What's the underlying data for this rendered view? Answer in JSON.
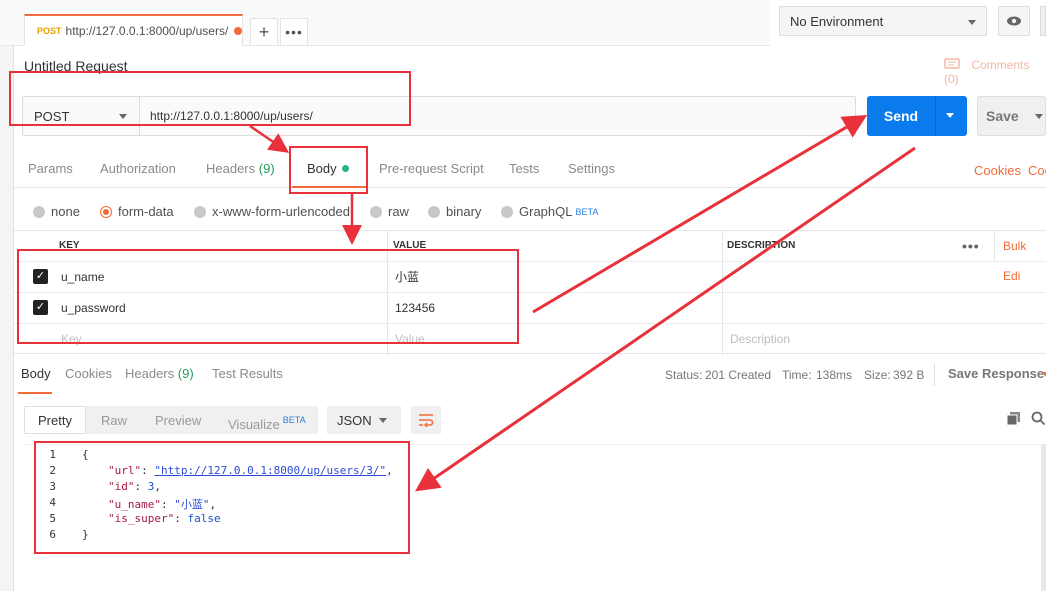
{
  "tab": {
    "method": "POST",
    "url": "http://127.0.0.1:8000/up/users/"
  },
  "environment": {
    "selected": "No Environment"
  },
  "request": {
    "title": "Untitled Request",
    "comments": "Comments (0)",
    "method": "POST",
    "url": "http://127.0.0.1:8000/up/users/",
    "send": "Send",
    "save": "Save"
  },
  "subtabs": {
    "params": "Params",
    "authorization": "Authorization",
    "headers": "Headers",
    "headers_count": "(9)",
    "body": "Body",
    "prerequest": "Pre-request Script",
    "tests": "Tests",
    "settings": "Settings",
    "cookies": "Cookies",
    "code": "Coc"
  },
  "body_types": {
    "none": "none",
    "form_data": "form-data",
    "urlencoded": "x-www-form-urlencoded",
    "raw": "raw",
    "binary": "binary",
    "graphql": "GraphQL",
    "beta": "BETA"
  },
  "kv": {
    "headers": {
      "key": "KEY",
      "value": "VALUE",
      "description": "DESCRIPTION",
      "bulk": "Bulk Edi"
    },
    "rows": [
      {
        "key": "u_name",
        "value": "小蓝",
        "checked": true
      },
      {
        "key": "u_password",
        "value": "123456",
        "checked": true
      }
    ],
    "placeholder": {
      "key": "Key",
      "value": "Value",
      "description": "Description"
    }
  },
  "response": {
    "tabs": {
      "body": "Body",
      "cookies": "Cookies",
      "headers": "Headers",
      "headers_count": "(9)",
      "tests": "Test Results"
    },
    "status_label": "Status:",
    "status_value": "201 Created",
    "time_label": "Time:",
    "time_value": "138ms",
    "size_label": "Size:",
    "size_value": "392 B",
    "save": "Save Response",
    "views": {
      "pretty": "Pretty",
      "raw": "Raw",
      "preview": "Preview",
      "visualize": "Visualize",
      "beta": "BETA"
    },
    "format": "JSON",
    "code": {
      "ln": [
        "1",
        "2",
        "3",
        "4",
        "5",
        "6"
      ],
      "open": "{",
      "url_key": "\"url\"",
      "url_val": "\"http://127.0.0.1:8000/up/users/3/\"",
      "id_key": "\"id\"",
      "id_val": "3",
      "name_key": "\"u_name\"",
      "name_val": "\"小蓝\"",
      "super_key": "\"is_super\"",
      "super_val": "false",
      "close": "}"
    }
  },
  "colors": {
    "accent": "#f26b3a",
    "send": "#097bed",
    "annotation": "#e8313a",
    "success": "#1f9d55"
  }
}
